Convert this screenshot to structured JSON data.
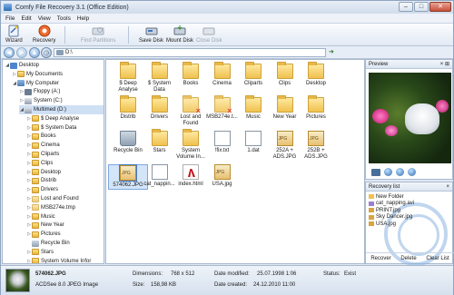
{
  "window": {
    "title": "Comfy File Recovery 3.1 (Office Edition)",
    "controls": {
      "minimize": "–",
      "maximize": "□",
      "close": "✕"
    }
  },
  "menu": [
    "File",
    "Edit",
    "View",
    "Tools",
    "Help"
  ],
  "toolbar": {
    "wizard": "Wizard",
    "recovery": "Recovery",
    "find_partitions": "Find Partitions",
    "save_disk": "Save Disk",
    "mount_disk": "Mount Disk",
    "close_disk": "Close Disk"
  },
  "address": {
    "path": "D:\\"
  },
  "tree": [
    {
      "label": "Desktop",
      "level": 0,
      "icon": "desktop-icon",
      "expanded": true
    },
    {
      "label": "My Documents",
      "level": 1,
      "icon": "folder-icon"
    },
    {
      "label": "My Computer",
      "level": 1,
      "icon": "computer-icon",
      "expanded": true
    },
    {
      "label": "Floppy (A:)",
      "level": 2,
      "icon": "floppy-icon"
    },
    {
      "label": "System (C:)",
      "level": 2,
      "icon": "drive-icon"
    },
    {
      "label": "Multimed (D:)",
      "level": 2,
      "icon": "drive-icon",
      "selected": true,
      "expanded": true
    },
    {
      "label": "$ Deep Analyse",
      "level": 3,
      "icon": "folder-icon"
    },
    {
      "label": "$ System Data",
      "level": 3,
      "icon": "folder-icon"
    },
    {
      "label": "Books",
      "level": 3,
      "icon": "folder-icon"
    },
    {
      "label": "Cinema",
      "level": 3,
      "icon": "folder-icon"
    },
    {
      "label": "Cliparts",
      "level": 3,
      "icon": "folder-icon"
    },
    {
      "label": "Clips",
      "level": 3,
      "icon": "folder-icon"
    },
    {
      "label": "Desktop",
      "level": 3,
      "icon": "folder-icon"
    },
    {
      "label": "Distrib",
      "level": 3,
      "icon": "folder-icon"
    },
    {
      "label": "Drivers",
      "level": 3,
      "icon": "folder-icon"
    },
    {
      "label": "Lost and Found",
      "level": 3,
      "icon": "deleted-folder-icon"
    },
    {
      "label": "MSB274e.tmp",
      "level": 3,
      "icon": "deleted-folder-icon"
    },
    {
      "label": "Music",
      "level": 3,
      "icon": "folder-icon"
    },
    {
      "label": "New Year",
      "level": 3,
      "icon": "folder-icon"
    },
    {
      "label": "Pictures",
      "level": 3,
      "icon": "folder-icon"
    },
    {
      "label": "Recycle Bin",
      "level": 3,
      "icon": "recycle-bin-icon"
    },
    {
      "label": "Stars",
      "level": 3,
      "icon": "folder-icon"
    },
    {
      "label": "System Volume Infor",
      "level": 3,
      "icon": "folder-icon"
    }
  ],
  "files": [
    {
      "name": "$ Deep\nAnalyse",
      "type": "folder"
    },
    {
      "name": "$ System\nData",
      "type": "folder"
    },
    {
      "name": "Books",
      "type": "folder"
    },
    {
      "name": "Cinema",
      "type": "folder"
    },
    {
      "name": "Cliparts",
      "type": "folder"
    },
    {
      "name": "Clips",
      "type": "folder"
    },
    {
      "name": "Desktop",
      "type": "folder"
    },
    {
      "name": "Distrib",
      "type": "folder"
    },
    {
      "name": "Drivers",
      "type": "folder"
    },
    {
      "name": "Lost and\nFound",
      "type": "deleted-folder"
    },
    {
      "name": "MSB274e.t...",
      "type": "deleted-folder"
    },
    {
      "name": "Music",
      "type": "folder"
    },
    {
      "name": "New Year",
      "type": "folder"
    },
    {
      "name": "Pictures",
      "type": "folder"
    },
    {
      "name": "Recycle Bin",
      "type": "recycle"
    },
    {
      "name": "Stars",
      "type": "folder"
    },
    {
      "name": "System\nVolume In...",
      "type": "folder"
    },
    {
      "name": "!fix.txt",
      "type": "doc"
    },
    {
      "name": "1.dat",
      "type": "doc"
    },
    {
      "name": "252A +\nADS.JPG",
      "type": "jpg"
    },
    {
      "name": "252B +\nADS.JPG",
      "type": "jpg"
    },
    {
      "name": "574062.JPG",
      "type": "jpg",
      "selected": true
    },
    {
      "name": "cat_nappin...",
      "type": "doc"
    },
    {
      "name": "index.html",
      "type": "pdf"
    },
    {
      "name": "USA.jpg",
      "type": "jpg"
    }
  ],
  "preview": {
    "header": "Preview",
    "pin": "× ⊞"
  },
  "recovery_list": {
    "header": "Recovery list",
    "items": [
      "New Folder",
      "cat_napping.avi",
      "PRINT.jpg",
      "Sky Dancer.jpg",
      "USA.jpg"
    ],
    "buttons": {
      "recover": "Recover",
      "delete": "Delete",
      "clear": "Clear List"
    }
  },
  "status": {
    "filename": "574062.JPG",
    "filetype": "ACDSee 8.0 JPEG Image",
    "dimensions_label": "Dimensions:",
    "dimensions": "768 x 512",
    "size_label": "Size:",
    "size": "158,98 KB",
    "modified_label": "Date modified:",
    "modified": "25.07.1998 1:06",
    "created_label": "Date created:",
    "created": "24.12.2010 11:00",
    "status_label": "Status:",
    "status": "Exist"
  }
}
